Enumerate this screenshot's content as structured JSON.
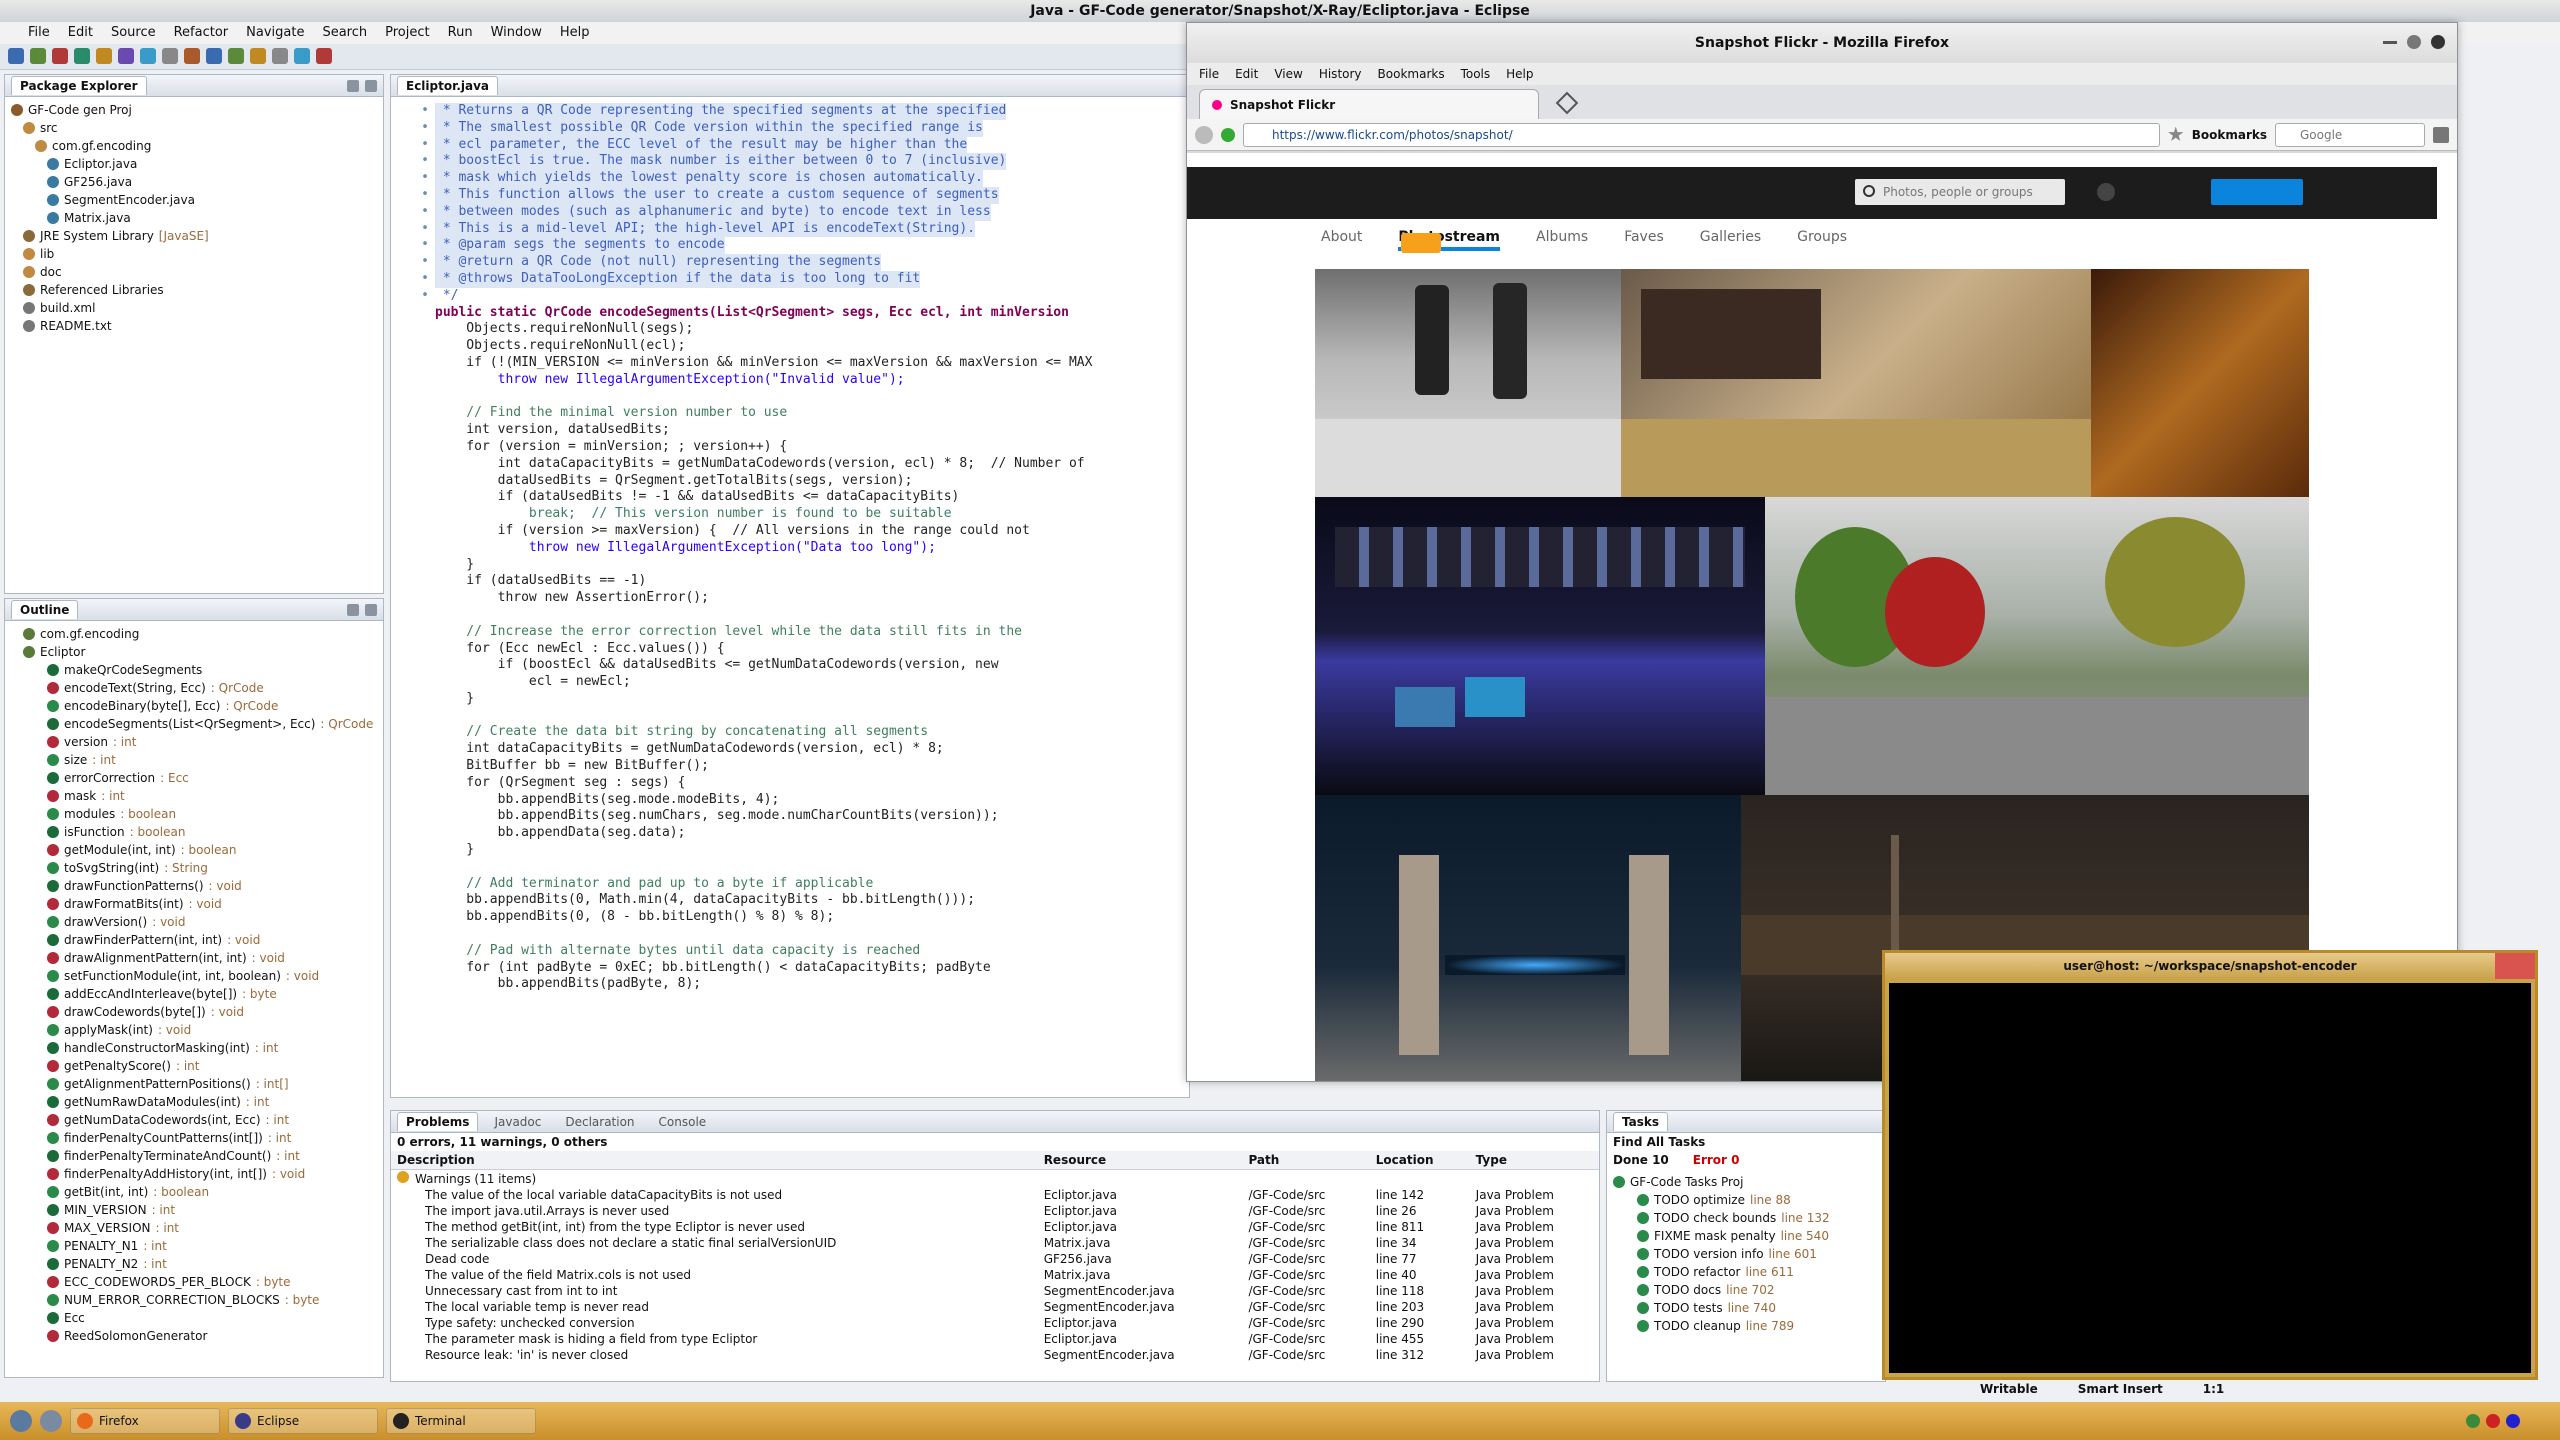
{
  "eclipse": {
    "title": "Java - GF-Code generator/Snapshot/X-Ray/Ecliptor.java - Eclipse",
    "menu": [
      "File",
      "Edit",
      "Source",
      "Refactor",
      "Navigate",
      "Search",
      "Project",
      "Run",
      "Window",
      "Help"
    ],
    "package_explorer": {
      "tab": "Package Explorer",
      "root": "GF-Code gen Proj",
      "items": [
        {
          "label": "src",
          "ann": ""
        },
        {
          "label": "com.gf.encoding",
          "ann": ""
        },
        {
          "label": "Ecliptor.java",
          "ann": ""
        },
        {
          "label": "GF256.java",
          "ann": ""
        },
        {
          "label": "SegmentEncoder.java",
          "ann": ""
        },
        {
          "label": "Matrix.java",
          "ann": ""
        },
        {
          "label": "JRE System Library",
          "ann": "[JavaSE]"
        },
        {
          "label": "lib",
          "ann": ""
        },
        {
          "label": "doc",
          "ann": ""
        },
        {
          "label": "Referenced Libraries",
          "ann": ""
        },
        {
          "label": "build.xml",
          "ann": ""
        },
        {
          "label": "README.txt",
          "ann": ""
        }
      ]
    },
    "outline": {
      "tab": "Outline",
      "items": [
        {
          "label": "com.gf.encoding",
          "ann": ""
        },
        {
          "label": "Ecliptor",
          "ann": ""
        },
        {
          "label": "makeQrCodeSegments",
          "ann": ""
        },
        {
          "label": "encodeText(String, Ecc)",
          "ann": ": QrCode"
        },
        {
          "label": "encodeBinary(byte[], Ecc)",
          "ann": ": QrCode"
        },
        {
          "label": "encodeSegments(List<QrSegment>, Ecc)",
          "ann": ": QrCode"
        },
        {
          "label": "version",
          "ann": ": int"
        },
        {
          "label": "size",
          "ann": ": int"
        },
        {
          "label": "errorCorrection",
          "ann": ": Ecc"
        },
        {
          "label": "mask",
          "ann": ": int"
        },
        {
          "label": "modules",
          "ann": ": boolean"
        },
        {
          "label": "isFunction",
          "ann": ": boolean"
        },
        {
          "label": "getModule(int, int)",
          "ann": ": boolean"
        },
        {
          "label": "toSvgString(int)",
          "ann": ": String"
        },
        {
          "label": "drawFunctionPatterns()",
          "ann": ": void"
        },
        {
          "label": "drawFormatBits(int)",
          "ann": ": void"
        },
        {
          "label": "drawVersion()",
          "ann": ": void"
        },
        {
          "label": "drawFinderPattern(int, int)",
          "ann": ": void"
        },
        {
          "label": "drawAlignmentPattern(int, int)",
          "ann": ": void"
        },
        {
          "label": "setFunctionModule(int, int, boolean)",
          "ann": ": void"
        },
        {
          "label": "addEccAndInterleave(byte[])",
          "ann": ": byte"
        },
        {
          "label": "drawCodewords(byte[])",
          "ann": ": void"
        },
        {
          "label": "applyMask(int)",
          "ann": ": void"
        },
        {
          "label": "handleConstructorMasking(int)",
          "ann": ": int"
        },
        {
          "label": "getPenaltyScore()",
          "ann": ": int"
        },
        {
          "label": "getAlignmentPatternPositions()",
          "ann": ": int[]"
        },
        {
          "label": "getNumRawDataModules(int)",
          "ann": ": int"
        },
        {
          "label": "getNumDataCodewords(int, Ecc)",
          "ann": ": int"
        },
        {
          "label": "finderPenaltyCountPatterns(int[])",
          "ann": ": int"
        },
        {
          "label": "finderPenaltyTerminateAndCount()",
          "ann": ": int"
        },
        {
          "label": "finderPenaltyAddHistory(int, int[])",
          "ann": ": void"
        },
        {
          "label": "getBit(int, int)",
          "ann": ": boolean"
        },
        {
          "label": "MIN_VERSION",
          "ann": ": int"
        },
        {
          "label": "MAX_VERSION",
          "ann": ": int"
        },
        {
          "label": "PENALTY_N1",
          "ann": ": int"
        },
        {
          "label": "PENALTY_N2",
          "ann": ": int"
        },
        {
          "label": "ECC_CODEWORDS_PER_BLOCK",
          "ann": ": byte"
        },
        {
          "label": "NUM_ERROR_CORRECTION_BLOCKS",
          "ann": ": byte"
        },
        {
          "label": "Ecc",
          "ann": ""
        },
        {
          "label": "ReedSolomonGenerator",
          "ann": ""
        }
      ]
    },
    "editor": {
      "tab": "Ecliptor.java",
      "lines": [
        {
          "cls": "c-comment doc-bg",
          "text": " * Returns a QR Code representing the specified segments at the specified"
        },
        {
          "cls": "c-comment doc-bg",
          "text": " * The smallest possible QR Code version within the specified range is"
        },
        {
          "cls": "c-comment doc-bg",
          "text": " * ecl parameter, the ECC level of the result may be higher than the"
        },
        {
          "cls": "c-comment doc-bg",
          "text": " * boostEcl is true. The mask number is either between 0 to 7 (inclusive)"
        },
        {
          "cls": "c-comment doc-bg",
          "text": " * mask which yields the lowest penalty score is chosen automatically."
        },
        {
          "cls": "c-comment doc-bg",
          "text": " * This function allows the user to create a custom sequence of segments"
        },
        {
          "cls": "c-comment doc-bg",
          "text": " * between modes (such as alphanumeric and byte) to encode text in less"
        },
        {
          "cls": "c-comment doc-bg",
          "text": " * This is a mid-level API; the high-level API is encodeText(String)."
        },
        {
          "cls": "c-comment doc-bg",
          "text": " * @param segs the segments to encode"
        },
        {
          "cls": "c-comment doc-bg",
          "text": " * @return a QR Code (not null) representing the segments"
        },
        {
          "cls": "c-comment doc-bg",
          "text": " * @throws DataTooLongException if the data is too long to fit"
        },
        {
          "cls": "c-comment",
          "text": " */"
        },
        {
          "cls": "c-kw",
          "text": "public static QrCode encodeSegments(List<QrSegment> segs, Ecc ecl, int minVersion"
        },
        {
          "cls": "c-plain",
          "text": "    Objects.requireNonNull(segs);"
        },
        {
          "cls": "c-plain",
          "text": "    Objects.requireNonNull(ecl);"
        },
        {
          "cls": "c-plain",
          "text": "    if (!(MIN_VERSION <= minVersion && minVersion <= maxVersion && maxVersion <= MAX"
        },
        {
          "cls": "c-str",
          "text": "        throw new IllegalArgumentException(\"Invalid value\");"
        },
        {
          "cls": "c-plain",
          "text": ""
        },
        {
          "cls": "c-green",
          "text": "    // Find the minimal version number to use"
        },
        {
          "cls": "c-plain",
          "text": "    int version, dataUsedBits;"
        },
        {
          "cls": "c-plain",
          "text": "    for (version = minVersion; ; version++) {"
        },
        {
          "cls": "c-plain",
          "text": "        int dataCapacityBits = getNumDataCodewords(version, ecl) * 8;  // Number of"
        },
        {
          "cls": "c-plain",
          "text": "        dataUsedBits = QrSegment.getTotalBits(segs, version);"
        },
        {
          "cls": "c-plain",
          "text": "        if (dataUsedBits != -1 && dataUsedBits <= dataCapacityBits)"
        },
        {
          "cls": "c-green",
          "text": "            break;  // This version number is found to be suitable"
        },
        {
          "cls": "c-plain",
          "text": "        if (version >= maxVersion) {  // All versions in the range could not"
        },
        {
          "cls": "c-str",
          "text": "            throw new IllegalArgumentException(\"Data too long\");"
        },
        {
          "cls": "c-plain",
          "text": "    }"
        },
        {
          "cls": "c-plain",
          "text": "    if (dataUsedBits == -1)"
        },
        {
          "cls": "c-plain",
          "text": "        throw new AssertionError();"
        },
        {
          "cls": "c-plain",
          "text": ""
        },
        {
          "cls": "c-green",
          "text": "    // Increase the error correction level while the data still fits in the"
        },
        {
          "cls": "c-plain",
          "text": "    for (Ecc newEcl : Ecc.values()) {"
        },
        {
          "cls": "c-plain",
          "text": "        if (boostEcl && dataUsedBits <= getNumDataCodewords(version, new"
        },
        {
          "cls": "c-plain",
          "text": "            ecl = newEcl;"
        },
        {
          "cls": "c-plain",
          "text": "    }"
        },
        {
          "cls": "c-plain",
          "text": ""
        },
        {
          "cls": "c-green",
          "text": "    // Create the data bit string by concatenating all segments"
        },
        {
          "cls": "c-plain",
          "text": "    int dataCapacityBits = getNumDataCodewords(version, ecl) * 8;"
        },
        {
          "cls": "c-plain",
          "text": "    BitBuffer bb = new BitBuffer();"
        },
        {
          "cls": "c-plain",
          "text": "    for (QrSegment seg : segs) {"
        },
        {
          "cls": "c-plain",
          "text": "        bb.appendBits(seg.mode.modeBits, 4);"
        },
        {
          "cls": "c-plain",
          "text": "        bb.appendBits(seg.numChars, seg.mode.numCharCountBits(version));"
        },
        {
          "cls": "c-plain",
          "text": "        bb.appendData(seg.data);"
        },
        {
          "cls": "c-plain",
          "text": "    }"
        },
        {
          "cls": "c-plain",
          "text": ""
        },
        {
          "cls": "c-green",
          "text": "    // Add terminator and pad up to a byte if applicable"
        },
        {
          "cls": "c-plain",
          "text": "    bb.appendBits(0, Math.min(4, dataCapacityBits - bb.bitLength()));"
        },
        {
          "cls": "c-plain",
          "text": "    bb.appendBits(0, (8 - bb.bitLength() % 8) % 8);"
        },
        {
          "cls": "c-plain",
          "text": ""
        },
        {
          "cls": "c-green",
          "text": "    // Pad with alternate bytes until data capacity is reached"
        },
        {
          "cls": "c-plain",
          "text": "    for (int padByte = 0xEC; bb.bitLength() < dataCapacityBits; padByte"
        },
        {
          "cls": "c-plain",
          "text": "        bb.appendBits(padByte, 8);"
        }
      ]
    },
    "problems": {
      "tabs": [
        "Problems",
        "Javadoc",
        "Declaration",
        "Console"
      ],
      "summary": "0 errors, 11 warnings, 0 others",
      "columns": [
        "Description",
        "Resource",
        "Path",
        "Location",
        "Type"
      ],
      "group": "Warnings (11 items)",
      "rows": [
        [
          "The value of the local variable dataCapacityBits is not used",
          "Ecliptor.java",
          "/GF-Code/src",
          "line 142",
          "Java Problem"
        ],
        [
          "The import java.util.Arrays is never used",
          "Ecliptor.java",
          "/GF-Code/src",
          "line 26",
          "Java Problem"
        ],
        [
          "The method getBit(int, int) from the type Ecliptor is never used",
          "Ecliptor.java",
          "/GF-Code/src",
          "line 811",
          "Java Problem"
        ],
        [
          "The serializable class does not declare a static final serialVersionUID",
          "Matrix.java",
          "/GF-Code/src",
          "line 34",
          "Java Problem"
        ],
        [
          "Dead code",
          "GF256.java",
          "/GF-Code/src",
          "line 77",
          "Java Problem"
        ],
        [
          "The value of the field Matrix.cols is not used",
          "Matrix.java",
          "/GF-Code/src",
          "line 40",
          "Java Problem"
        ],
        [
          "Unnecessary cast from int to int",
          "SegmentEncoder.java",
          "/GF-Code/src",
          "line 118",
          "Java Problem"
        ],
        [
          "The local variable temp is never read",
          "SegmentEncoder.java",
          "/GF-Code/src",
          "line 203",
          "Java Problem"
        ],
        [
          "Type safety: unchecked conversion",
          "Ecliptor.java",
          "/GF-Code/src",
          "line 290",
          "Java Problem"
        ],
        [
          "The parameter mask is hiding a field from type Ecliptor",
          "Ecliptor.java",
          "/GF-Code/src",
          "line 455",
          "Java Problem"
        ],
        [
          "Resource leak: 'in' is never closed",
          "SegmentEncoder.java",
          "/GF-Code/src",
          "line 312",
          "Java Problem"
        ]
      ]
    },
    "tasks": {
      "tab": "Tasks",
      "filter": "Find All Tasks",
      "summary_left": "Done 10",
      "summary_right": "Error 0",
      "root": "GF-Code Tasks Proj",
      "items": [
        {
          "label": "TODO optimize",
          "ann": "line 88"
        },
        {
          "label": "TODO check bounds",
          "ann": "line 132"
        },
        {
          "label": "FIXME mask penalty",
          "ann": "line 540"
        },
        {
          "label": "TODO version info",
          "ann": "line 601"
        },
        {
          "label": "TODO refactor",
          "ann": "line 611"
        },
        {
          "label": "TODO docs",
          "ann": "line 702"
        },
        {
          "label": "TODO tests",
          "ann": "line 740"
        },
        {
          "label": "TODO cleanup",
          "ann": "line 789"
        }
      ]
    },
    "status": {
      "writable": "Writable",
      "insert": "Smart Insert",
      "position": "1:1"
    }
  },
  "firefox": {
    "title": "Snapshot Flickr - Mozilla Firefox",
    "menu": [
      "File",
      "Edit",
      "View",
      "History",
      "Bookmarks",
      "Tools",
      "Help"
    ],
    "tab_title": "Snapshot Flickr",
    "url": "https://www.flickr.com/photos/snapshot/",
    "search_engine": "Google",
    "bookmarks_label": "Bookmarks",
    "flickr_search_placeholder": "Photos, people or groups",
    "nav": [
      "About",
      "Photostream",
      "Albums",
      "Faves",
      "Galleries",
      "Groups"
    ],
    "active_nav": "Photostream"
  },
  "terminal": {
    "title": "user@host: ~/workspace/snapshot-encoder"
  },
  "taskbar": {
    "items": [
      "Firefox",
      "Eclipse",
      "Terminal"
    ]
  }
}
